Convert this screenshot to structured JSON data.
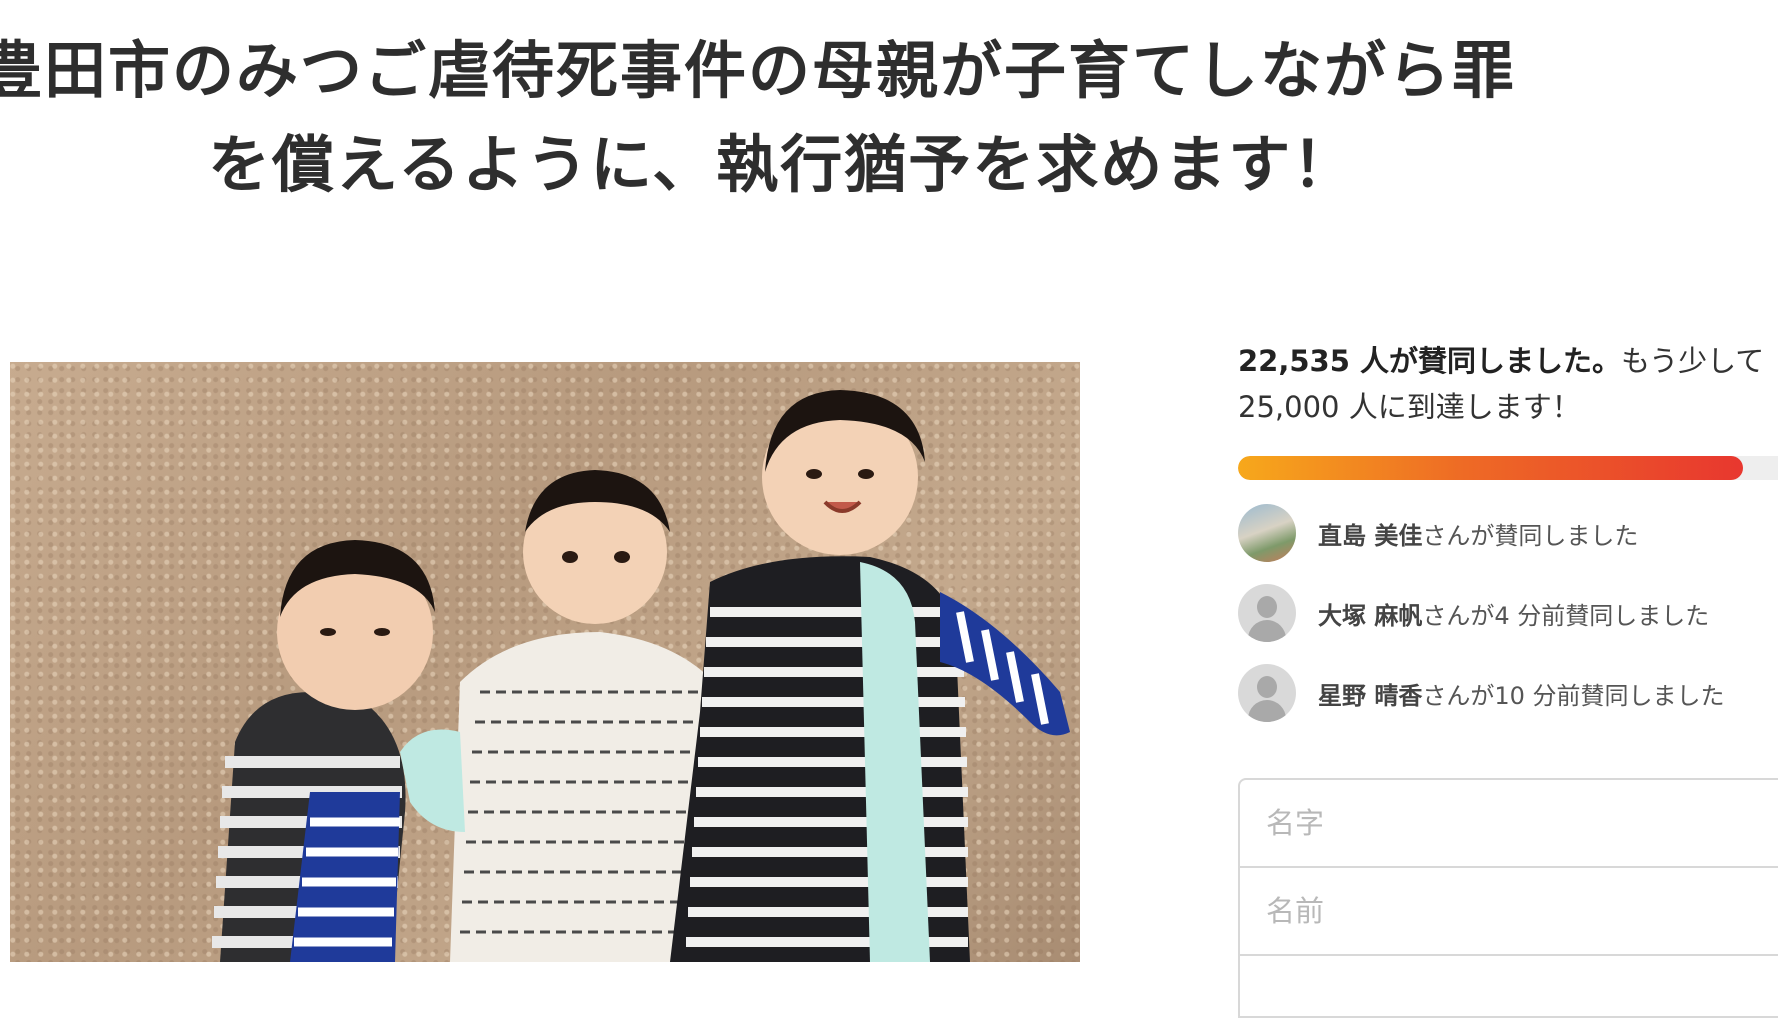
{
  "petition": {
    "title_line1": "豊田市のみつご虐待死事件の母親が子育てしながら罪",
    "title_line2": "を償えるように、執行猶予を求めます！"
  },
  "signatures": {
    "count_bold": "22,535 人が賛同しました。",
    "count_rest": "もう少して",
    "goal_text": "25,000 人に到達します！",
    "progress_fraction": 0.9014
  },
  "activity": [
    {
      "name": "直島 美佳",
      "suffix": "さんが賛同しました",
      "avatar": "photo-avatar"
    },
    {
      "name": "大塚 麻帆",
      "suffix": "さんが4 分前賛同しました",
      "avatar": "person-silhouette-icon"
    },
    {
      "name": "星野 晴香",
      "suffix": "さんが10 分前賛同しました",
      "avatar": "person-silhouette-icon"
    }
  ],
  "form": {
    "last_name_placeholder": "名字",
    "first_name_placeholder": "名前"
  },
  "colors": {
    "progress_start": "#f7a81b",
    "progress_end": "#e8372f"
  }
}
